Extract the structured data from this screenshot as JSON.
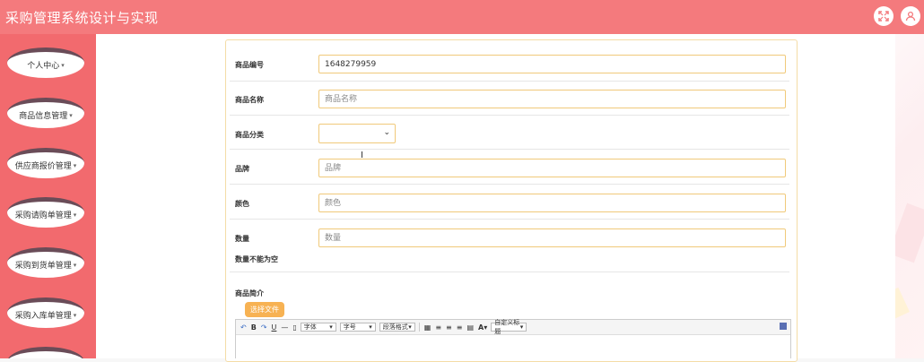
{
  "header": {
    "title": "采购管理系统设计与实现"
  },
  "sidebar": {
    "items": [
      {
        "label": "个人中心"
      },
      {
        "label": "商品信息管理"
      },
      {
        "label": "供应商报价管理"
      },
      {
        "label": "采购请购单管理"
      },
      {
        "label": "采购到货单管理"
      },
      {
        "label": "采购入库单管理"
      },
      {
        "label": ""
      }
    ]
  },
  "form": {
    "code": {
      "label": "商品编号",
      "value": "1648279959"
    },
    "name": {
      "label": "商品名称",
      "placeholder": "商品名称"
    },
    "category": {
      "label": "商品分类",
      "selected": ""
    },
    "brand": {
      "label": "品牌",
      "placeholder": "品牌"
    },
    "color": {
      "label": "颜色",
      "placeholder": "颜色"
    },
    "quantity": {
      "label": "数量",
      "placeholder": "数量",
      "error": "数量不能为空"
    },
    "intro": {
      "label": "商品简介"
    },
    "upload_label": "选择文件"
  },
  "editor_toolbar": {
    "font_family": "字体",
    "font_size": "字号",
    "paragraph": "段落格式",
    "custom_title": "自定义标题",
    "font_color_glyph": "A"
  },
  "colors": {
    "header": "#f47a7d",
    "sidebar": "#f26a6e",
    "accent": "#f7b253",
    "field_border": "#f0c97a"
  }
}
